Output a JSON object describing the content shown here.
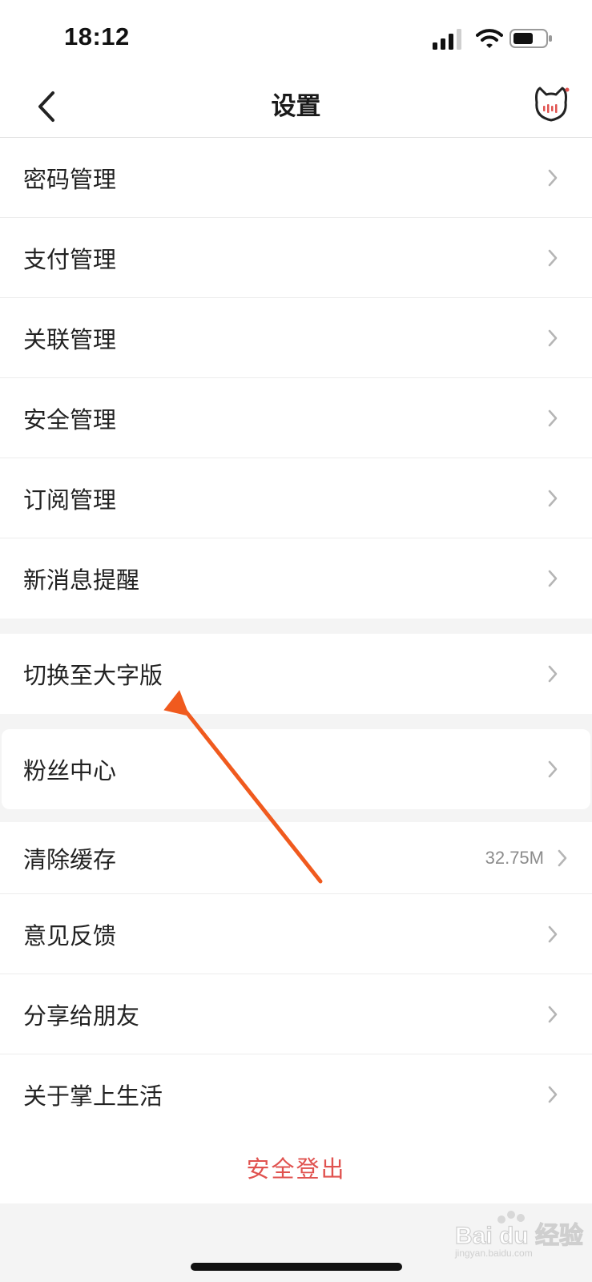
{
  "status_bar": {
    "time": "18:12"
  },
  "header": {
    "title": "设置"
  },
  "settings": {
    "group1": [
      {
        "label": "密码管理"
      },
      {
        "label": "支付管理"
      },
      {
        "label": "关联管理"
      },
      {
        "label": "安全管理"
      },
      {
        "label": "订阅管理"
      },
      {
        "label": "新消息提醒"
      }
    ],
    "large_font": {
      "label": "切换至大字版"
    },
    "fans_center": {
      "label": "粉丝中心"
    },
    "group2": [
      {
        "label": "清除缓存",
        "value": "32.75M"
      },
      {
        "label": "意见反馈"
      },
      {
        "label": "分享给朋友"
      },
      {
        "label": "关于掌上生活"
      }
    ]
  },
  "logout": {
    "label": "安全登出"
  },
  "watermark": {
    "text": "Bai 经验",
    "sub": "jingyan.baidu.com"
  },
  "colors": {
    "logout_text": "#e0524f",
    "annotation_arrow": "#f05a1e",
    "background": "#f4f4f4"
  },
  "icons": [
    "back-icon",
    "mascot-icon",
    "signal-icon",
    "wifi-icon",
    "battery-icon",
    "chevron-right-icon"
  ]
}
